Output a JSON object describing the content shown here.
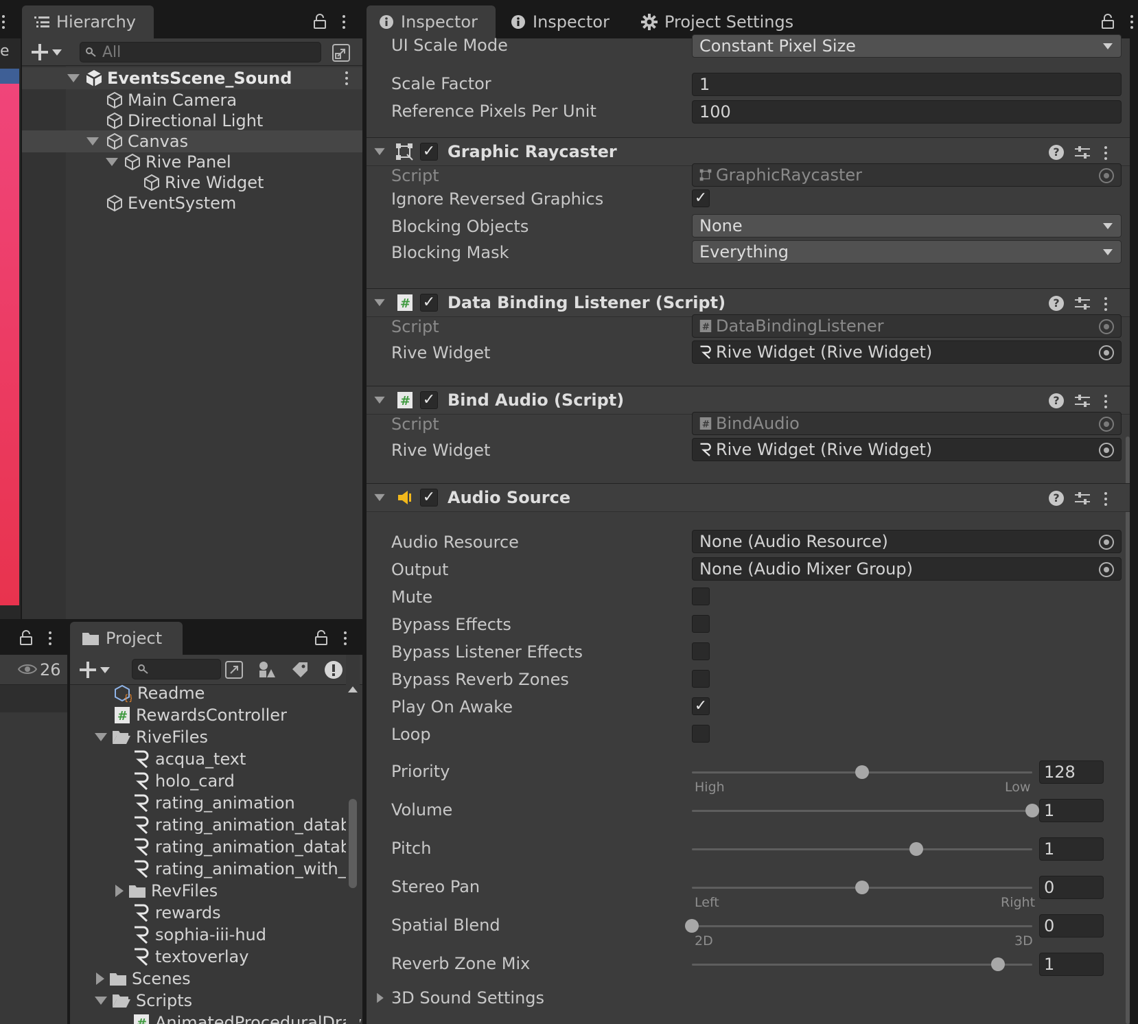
{
  "hierarchy": {
    "tab_label": "Hierarchy",
    "search_placeholder": "All",
    "scene_name": "EventsScene_Sound",
    "items": [
      {
        "label": "Main Camera"
      },
      {
        "label": "Directional Light"
      },
      {
        "label": "Canvas"
      },
      {
        "label": "Rive Panel"
      },
      {
        "label": "Rive Widget"
      },
      {
        "label": "EventSystem"
      }
    ],
    "left_stub_label": "e"
  },
  "inspector_tabs": [
    {
      "label": "Inspector"
    },
    {
      "label": "Inspector"
    },
    {
      "label": "Project Settings"
    }
  ],
  "canvas_scaler": {
    "ui_scale_mode_label": "UI Scale Mode",
    "ui_scale_mode_value": "Constant Pixel Size",
    "scale_factor_label": "Scale Factor",
    "scale_factor_value": "1",
    "ref_ppu_label": "Reference Pixels Per Unit",
    "ref_ppu_value": "100"
  },
  "graphic_raycaster": {
    "title": "Graphic Raycaster",
    "script_label": "Script",
    "script_value": "GraphicRaycaster",
    "ignore_label": "Ignore Reversed Graphics",
    "ignore_checked": true,
    "blocking_objects_label": "Blocking Objects",
    "blocking_objects_value": "None",
    "blocking_mask_label": "Blocking Mask",
    "blocking_mask_value": "Everything"
  },
  "data_binding": {
    "title": "Data Binding Listener (Script)",
    "script_label": "Script",
    "script_value": "DataBindingListener",
    "widget_label": "Rive Widget",
    "widget_value": "Rive Widget (Rive Widget)"
  },
  "bind_audio": {
    "title": "Bind Audio (Script)",
    "script_label": "Script",
    "script_value": "BindAudio",
    "widget_label": "Rive Widget",
    "widget_value": "Rive Widget (Rive Widget)"
  },
  "audio_source": {
    "title": "Audio Source",
    "resource_label": "Audio Resource",
    "resource_value": "None (Audio Resource)",
    "output_label": "Output",
    "output_value": "None (Audio Mixer Group)",
    "toggles": [
      {
        "label": "Mute",
        "checked": false
      },
      {
        "label": "Bypass Effects",
        "checked": false
      },
      {
        "label": "Bypass Listener Effects",
        "checked": false
      },
      {
        "label": "Bypass Reverb Zones",
        "checked": false
      },
      {
        "label": "Play On Awake",
        "checked": true
      },
      {
        "label": "Loop",
        "checked": false
      }
    ],
    "sliders": [
      {
        "label": "Priority",
        "value": "128",
        "fraction": 0.5,
        "min_cap": "High",
        "max_cap": "Low"
      },
      {
        "label": "Volume",
        "value": "1",
        "fraction": 1.0,
        "min_cap": "",
        "max_cap": ""
      },
      {
        "label": "Pitch",
        "value": "1",
        "fraction": 0.66,
        "min_cap": "",
        "max_cap": ""
      },
      {
        "label": "Stereo Pan",
        "value": "0",
        "fraction": 0.5,
        "min_cap": "Left",
        "max_cap": "Right"
      },
      {
        "label": "Spatial Blend",
        "value": "0",
        "fraction": 0.0,
        "min_cap": "2D",
        "max_cap": "3D"
      },
      {
        "label": "Reverb Zone Mix",
        "value": "1",
        "fraction": 0.9,
        "min_cap": "",
        "max_cap": ""
      }
    ],
    "sound_settings_label": "3D Sound Settings"
  },
  "project": {
    "tab_label": "Project",
    "visible_count": "26",
    "items": [
      {
        "label": "Readme",
        "icon": "readme-icon"
      },
      {
        "label": "RewardsController",
        "icon": "script-icon"
      },
      {
        "label": "RiveFiles",
        "icon": "folder-open-icon"
      },
      {
        "label": "acqua_text",
        "icon": "rive-icon"
      },
      {
        "label": "holo_card",
        "icon": "rive-icon"
      },
      {
        "label": "rating_animation",
        "icon": "rive-icon"
      },
      {
        "label": "rating_animation_databi",
        "icon": "rive-icon"
      },
      {
        "label": "rating_animation_databi",
        "icon": "rive-icon"
      },
      {
        "label": "rating_animation_with_e",
        "icon": "rive-icon"
      },
      {
        "label": "RevFiles",
        "icon": "folder-icon"
      },
      {
        "label": "rewards",
        "icon": "rive-icon"
      },
      {
        "label": "sophia-iii-hud",
        "icon": "rive-icon"
      },
      {
        "label": "textoverlay",
        "icon": "rive-icon"
      },
      {
        "label": "Scenes",
        "icon": "folder-icon"
      },
      {
        "label": "Scripts",
        "icon": "folder-open-icon"
      },
      {
        "label": "AnimatedProceduralDrav",
        "icon": "script-icon"
      }
    ]
  },
  "colors": {
    "accent_speaker": "#f2b81c",
    "script_hash": "#3f9a3f",
    "scene_preview": "#ef4273"
  }
}
